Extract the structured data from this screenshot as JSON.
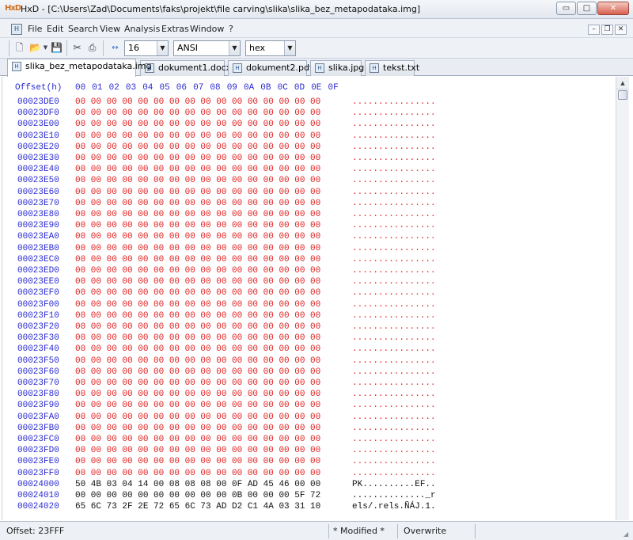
{
  "window": {
    "app_icon_text": "HxD",
    "title": "HxD - [C:\\Users\\Zad\\Documents\\faks\\projekt\\file carving\\slika\\slika_bez_metapodataka.img]",
    "min_symbol": "▭",
    "max_symbol": "□",
    "close_symbol": "✕"
  },
  "menu": {
    "items": [
      "File",
      "Edit",
      "Search",
      "View",
      "Analysis",
      "Extras",
      "Window",
      "?"
    ],
    "mdi_min": "–",
    "mdi_restore": "❐",
    "mdi_close": "✕"
  },
  "toolbar": {
    "bytes_per_row": "16",
    "charset": "ANSI",
    "offset_base": "hex",
    "arrows_symbol": "↔"
  },
  "tabs": [
    {
      "label": "slika_bez_metapodataka.img",
      "active": true
    },
    {
      "label": "dokument1.docx",
      "active": false
    },
    {
      "label": "dokument2.pdf",
      "active": false
    },
    {
      "label": "slika.jpg",
      "active": false
    },
    {
      "label": "tekst.txt",
      "active": false
    }
  ],
  "hex_header": {
    "offset_label": "Offset(h)",
    "columns": [
      "00",
      "01",
      "02",
      "03",
      "04",
      "05",
      "06",
      "07",
      "08",
      "09",
      "0A",
      "0B",
      "0C",
      "0D",
      "0E",
      "0F"
    ]
  },
  "rows": [
    {
      "offset": "00023DE0",
      "hex": "00 00 00 00 00 00 00 00 00 00 00 00 00 00 00 00",
      "ascii": "................"
    },
    {
      "offset": "00023DF0",
      "hex": "00 00 00 00 00 00 00 00 00 00 00 00 00 00 00 00",
      "ascii": "................"
    },
    {
      "offset": "00023E00",
      "hex": "00 00 00 00 00 00 00 00 00 00 00 00 00 00 00 00",
      "ascii": "................"
    },
    {
      "offset": "00023E10",
      "hex": "00 00 00 00 00 00 00 00 00 00 00 00 00 00 00 00",
      "ascii": "................"
    },
    {
      "offset": "00023E20",
      "hex": "00 00 00 00 00 00 00 00 00 00 00 00 00 00 00 00",
      "ascii": "................"
    },
    {
      "offset": "00023E30",
      "hex": "00 00 00 00 00 00 00 00 00 00 00 00 00 00 00 00",
      "ascii": "................"
    },
    {
      "offset": "00023E40",
      "hex": "00 00 00 00 00 00 00 00 00 00 00 00 00 00 00 00",
      "ascii": "................"
    },
    {
      "offset": "00023E50",
      "hex": "00 00 00 00 00 00 00 00 00 00 00 00 00 00 00 00",
      "ascii": "................"
    },
    {
      "offset": "00023E60",
      "hex": "00 00 00 00 00 00 00 00 00 00 00 00 00 00 00 00",
      "ascii": "................"
    },
    {
      "offset": "00023E70",
      "hex": "00 00 00 00 00 00 00 00 00 00 00 00 00 00 00 00",
      "ascii": "................"
    },
    {
      "offset": "00023E80",
      "hex": "00 00 00 00 00 00 00 00 00 00 00 00 00 00 00 00",
      "ascii": "................"
    },
    {
      "offset": "00023E90",
      "hex": "00 00 00 00 00 00 00 00 00 00 00 00 00 00 00 00",
      "ascii": "................"
    },
    {
      "offset": "00023EA0",
      "hex": "00 00 00 00 00 00 00 00 00 00 00 00 00 00 00 00",
      "ascii": "................"
    },
    {
      "offset": "00023EB0",
      "hex": "00 00 00 00 00 00 00 00 00 00 00 00 00 00 00 00",
      "ascii": "................"
    },
    {
      "offset": "00023EC0",
      "hex": "00 00 00 00 00 00 00 00 00 00 00 00 00 00 00 00",
      "ascii": "................"
    },
    {
      "offset": "00023ED0",
      "hex": "00 00 00 00 00 00 00 00 00 00 00 00 00 00 00 00",
      "ascii": "................"
    },
    {
      "offset": "00023EE0",
      "hex": "00 00 00 00 00 00 00 00 00 00 00 00 00 00 00 00",
      "ascii": "................"
    },
    {
      "offset": "00023EF0",
      "hex": "00 00 00 00 00 00 00 00 00 00 00 00 00 00 00 00",
      "ascii": "................"
    },
    {
      "offset": "00023F00",
      "hex": "00 00 00 00 00 00 00 00 00 00 00 00 00 00 00 00",
      "ascii": "................"
    },
    {
      "offset": "00023F10",
      "hex": "00 00 00 00 00 00 00 00 00 00 00 00 00 00 00 00",
      "ascii": "................"
    },
    {
      "offset": "00023F20",
      "hex": "00 00 00 00 00 00 00 00 00 00 00 00 00 00 00 00",
      "ascii": "................"
    },
    {
      "offset": "00023F30",
      "hex": "00 00 00 00 00 00 00 00 00 00 00 00 00 00 00 00",
      "ascii": "................"
    },
    {
      "offset": "00023F40",
      "hex": "00 00 00 00 00 00 00 00 00 00 00 00 00 00 00 00",
      "ascii": "................"
    },
    {
      "offset": "00023F50",
      "hex": "00 00 00 00 00 00 00 00 00 00 00 00 00 00 00 00",
      "ascii": "................"
    },
    {
      "offset": "00023F60",
      "hex": "00 00 00 00 00 00 00 00 00 00 00 00 00 00 00 00",
      "ascii": "................"
    },
    {
      "offset": "00023F70",
      "hex": "00 00 00 00 00 00 00 00 00 00 00 00 00 00 00 00",
      "ascii": "................"
    },
    {
      "offset": "00023F80",
      "hex": "00 00 00 00 00 00 00 00 00 00 00 00 00 00 00 00",
      "ascii": "................"
    },
    {
      "offset": "00023F90",
      "hex": "00 00 00 00 00 00 00 00 00 00 00 00 00 00 00 00",
      "ascii": "................"
    },
    {
      "offset": "00023FA0",
      "hex": "00 00 00 00 00 00 00 00 00 00 00 00 00 00 00 00",
      "ascii": "................"
    },
    {
      "offset": "00023FB0",
      "hex": "00 00 00 00 00 00 00 00 00 00 00 00 00 00 00 00",
      "ascii": "................"
    },
    {
      "offset": "00023FC0",
      "hex": "00 00 00 00 00 00 00 00 00 00 00 00 00 00 00 00",
      "ascii": "................"
    },
    {
      "offset": "00023FD0",
      "hex": "00 00 00 00 00 00 00 00 00 00 00 00 00 00 00 00",
      "ascii": "................"
    },
    {
      "offset": "00023FE0",
      "hex": "00 00 00 00 00 00 00 00 00 00 00 00 00 00 00 00",
      "ascii": "................"
    },
    {
      "offset": "00023FF0",
      "hex": "00 00 00 00 00 00 00 00 00 00 00 00 00 00 00 00",
      "ascii": "................"
    },
    {
      "offset": "00024000",
      "hex": "50 4B 03 04 14 00 08 08 08 00 0F AD 45 46 00 00",
      "ascii": "PK..........EF.."
    },
    {
      "offset": "00024010",
      "hex": "00 00 00 00 00 00 00 00 00 00 0B 00 00 00 5F 72",
      "ascii": ".............._r"
    },
    {
      "offset": "00024020",
      "hex": "65 6C 73 2F 2E 72 65 6C 73 AD D2 C1 4A 03 31 10",
      "ascii": "els/.rels.ÑÁJ.1."
    }
  ],
  "status": {
    "offset": "Offset: 23FFF",
    "modified": "* Modified *",
    "mode": "Overwrite"
  }
}
